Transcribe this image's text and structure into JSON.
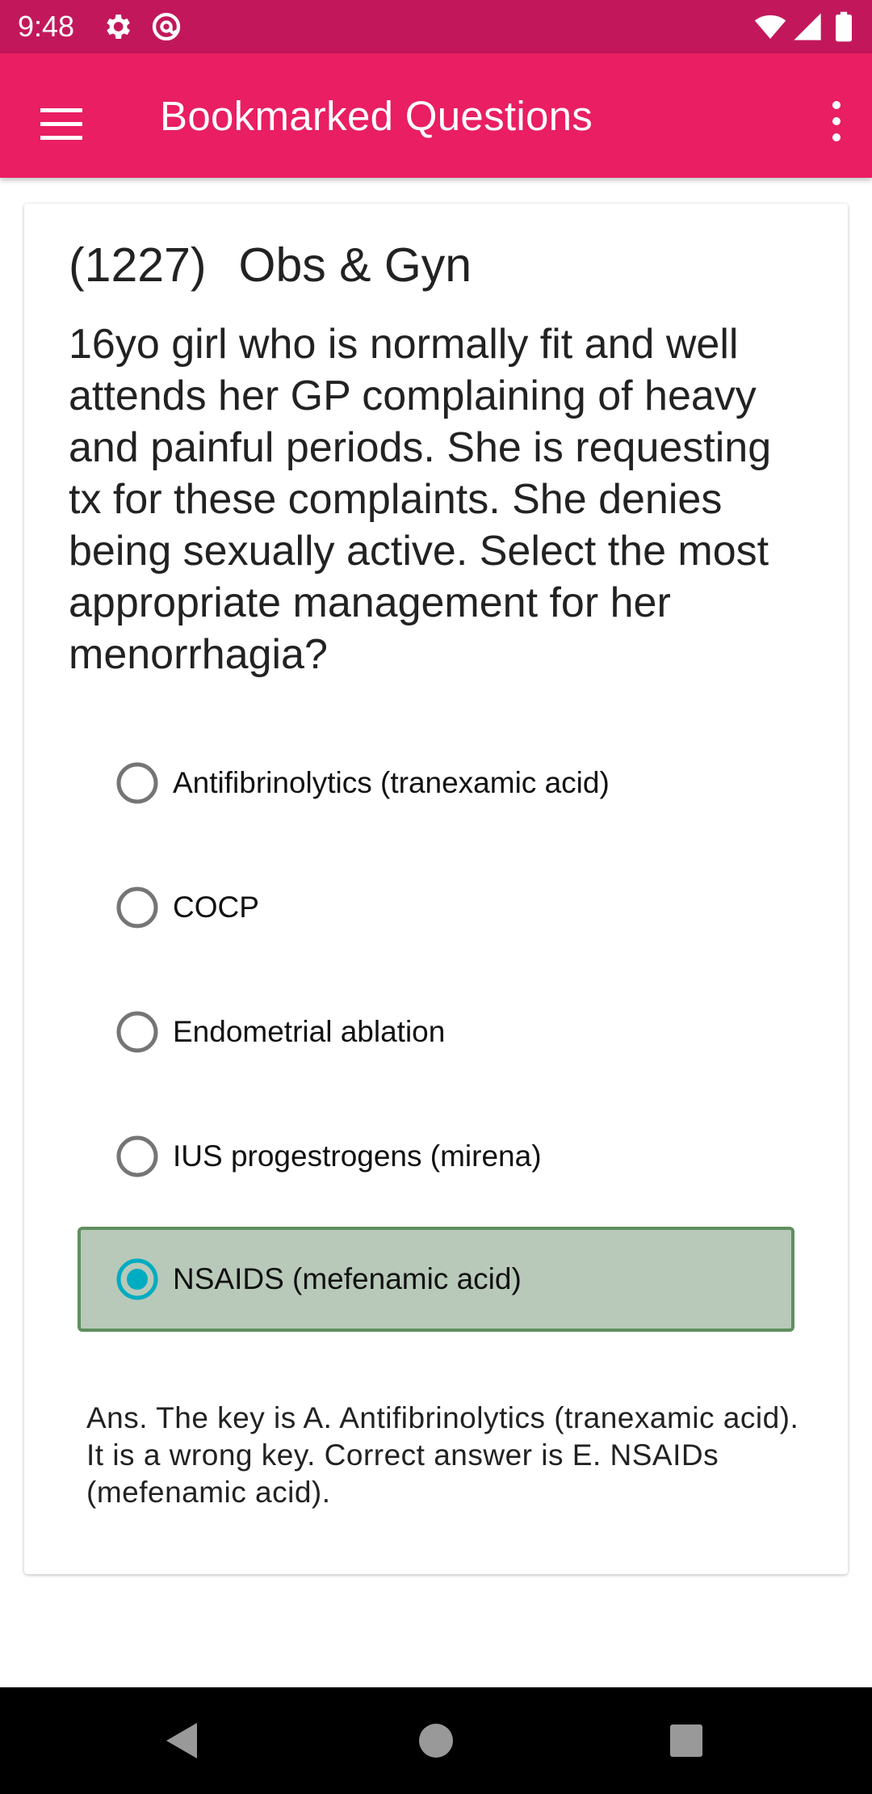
{
  "status_bar": {
    "time": "9:48",
    "left_icons": [
      "gear-icon",
      "at-sign-icon"
    ],
    "right_icons": [
      "wifi-icon",
      "signal-icon",
      "battery-icon"
    ],
    "color": "#c2185b"
  },
  "app_bar": {
    "title": "Bookmarked Questions",
    "color": "#e91e63"
  },
  "question": {
    "number": "(1227)",
    "category": "Obs & Gyn",
    "text": "16yo girl who is normally fit and well attends her GP complaining of heavy and painful periods. She is requesting tx for these complaints. She denies being sexually active. Select the most appropriate management for her menorrhagia?"
  },
  "options": [
    {
      "label": "Antifibrinolytics (tranexamic acid)",
      "selected": false
    },
    {
      "label": "COCP",
      "selected": false
    },
    {
      "label": "Endometrial ablation",
      "selected": false
    },
    {
      "label": "IUS progestrogens (mirena)",
      "selected": false
    },
    {
      "label": "NSAIDS (mefenamic acid)",
      "selected": true
    }
  ],
  "answer": "Ans. The key is A. Antifibrinolytics (tranexamic acid). It is a wrong key. Correct answer is E. NSAIDs (mefenamic acid).",
  "colors": {
    "selected_background": "#b8c9b9",
    "selected_border": "#5f8f5f",
    "radio_selected": "#00acc1"
  }
}
